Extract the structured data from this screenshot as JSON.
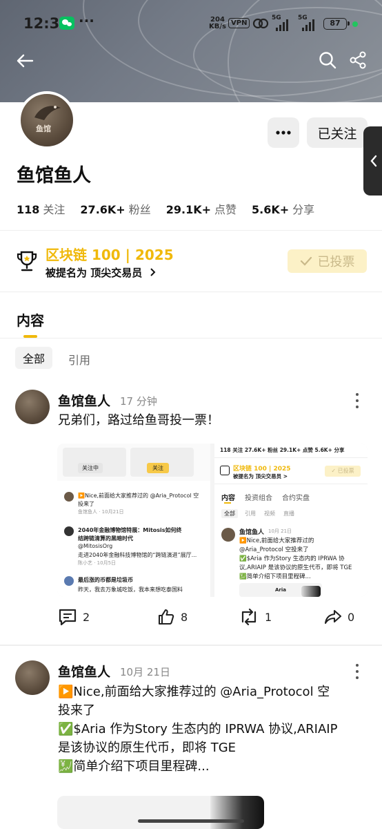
{
  "status": {
    "time": "12:31",
    "dots": "···",
    "net_speed_value": "204",
    "net_speed_unit": "KB/s",
    "vpn": "VPN",
    "sig1": "5G",
    "sig2": "5G",
    "battery": "87"
  },
  "profile": {
    "name": "鱼馆鱼人",
    "avatar_text": "鱼馆",
    "follow_button": "已关注",
    "stats": [
      {
        "num": "118",
        "label": "关注"
      },
      {
        "num": "27.6K+",
        "label": "粉丝"
      },
      {
        "num": "29.1K+",
        "label": "点赞"
      },
      {
        "num": "5.6K+",
        "label": "分享"
      }
    ]
  },
  "award": {
    "title": "区块链 100 | 2025",
    "subtitle": "被提名为 顶尖交易员",
    "voted_label": "已投票"
  },
  "tabs": {
    "main": "内容",
    "filter_all": "全部",
    "filter_quote": "引用"
  },
  "posts": [
    {
      "author": "鱼馆鱼人",
      "time": "17 分钟",
      "text": "兄弟们，路过给鱼哥投一票！",
      "actions": {
        "comments": "2",
        "likes": "8",
        "reposts": "1",
        "shares": "0"
      },
      "image_left": {
        "following_tab": "关注中",
        "follow_tab": "关注",
        "item1_text_a": "▶️Nice,前面给大家推荐过的 @Aria_Protocol 空",
        "item1_text_b": "投来了",
        "item1_meta": "鱼馆鱼人 · 10月21日",
        "item2_title_a": "2040年金融博物馆特展：Mitosis如何终",
        "item2_title_b": "结跨链清算的黑暗时代",
        "item2_author": "@MitosisOrg",
        "item2_desc": "走进2040年金融科技博物馆的“跨链演进”展厅...",
        "item2_meta": "陈小艺 · 10月5日",
        "item3_title": "最后涨的币都是垃圾币",
        "item3_desc": "昨天，我去万象城吃饭，我本来想吃泰国料"
      },
      "image_right": {
        "stats": "118 关注   27.6K+ 粉丝   29.1K+ 点赞   5.6K+ 分享",
        "award_title": "区块链 100 | 2025",
        "award_sub": "被提名为 顶尖交易员 >",
        "voted": "✓ 已投票",
        "tab1": "内容",
        "tab2": "投资组合",
        "tab3": "合约实盘",
        "chip1": "全部",
        "chip2": "引用",
        "chip3": "视频",
        "chip4": "直播",
        "post_author": "鱼馆鱼人",
        "post_time": "10月 21日",
        "post_line1": "▶️Nice,前面给大家推荐过的",
        "post_line2": "@Aria_Protocol 空投来了",
        "post_line3": "✅$Aria 作为Story 生态内的 IPRWA 协",
        "post_line4": "议,ARIAIP 是该协议的原生代币，即将 TGE",
        "post_line5": "💹简单介绍下项目里程碑...",
        "brand": "Aria"
      }
    },
    {
      "author": "鱼馆鱼人",
      "time": "10月 21日",
      "line1": "▶️Nice,前面给大家推荐过的 @Aria_Protocol 空",
      "line2": "投来了",
      "line3": "✅$Aria 作为Story 生态内的 IPRWA 协议,ARIAIP",
      "line4": "是该协议的原生代币，即将 TGE",
      "line5": "💹简单介绍下项目里程碑..."
    }
  ],
  "colors": {
    "accent": "#f0b90b",
    "voted_bg": "#fcf1c7",
    "banner": "#6b717c"
  }
}
